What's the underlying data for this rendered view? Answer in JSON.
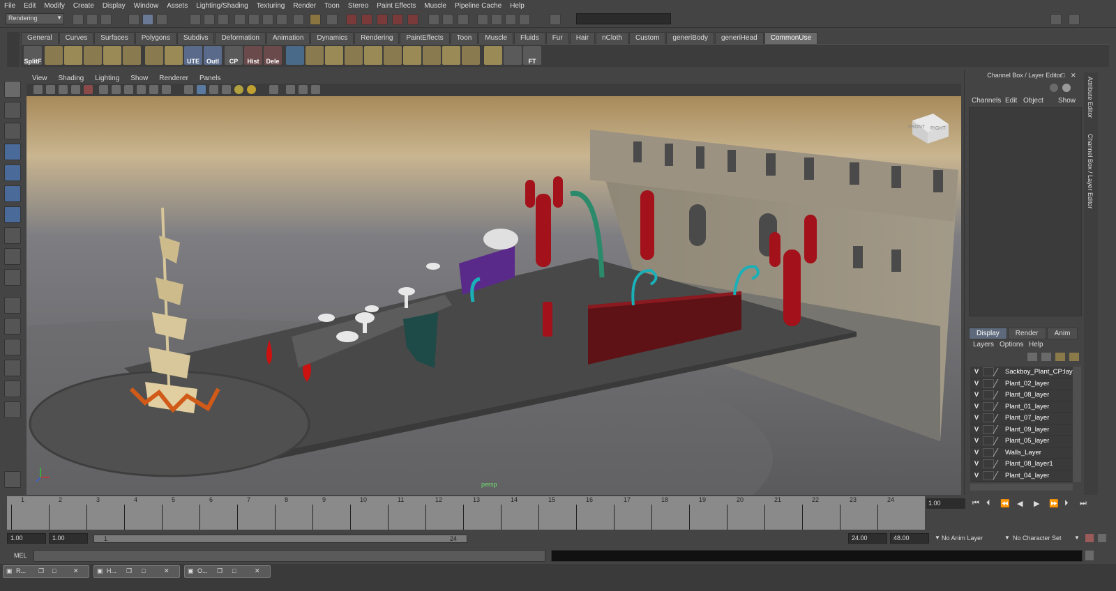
{
  "menubar": [
    "File",
    "Edit",
    "Modify",
    "Create",
    "Display",
    "Window",
    "Assets",
    "Lighting/Shading",
    "Texturing",
    "Render",
    "Toon",
    "Stereo",
    "Paint Effects",
    "Muscle",
    "Pipeline Cache",
    "Help"
  ],
  "status": {
    "mode": "Rendering"
  },
  "shelf": {
    "tabs": [
      "General",
      "Curves",
      "Surfaces",
      "Polygons",
      "Subdivs",
      "Deformation",
      "Animation",
      "Dynamics",
      "Rendering",
      "PaintEffects",
      "Toon",
      "Muscle",
      "Fluids",
      "Fur",
      "Hair",
      "nCloth",
      "Custom",
      "generiBody",
      "generiHead",
      "CommonUse"
    ],
    "active_tab": "CommonUse",
    "buttons": [
      "SplitF",
      "UTE",
      "Outl",
      "CP",
      "Hist",
      "Dele",
      "FT"
    ]
  },
  "viewport": {
    "menu": [
      "View",
      "Shading",
      "Lighting",
      "Show",
      "Renderer",
      "Panels"
    ],
    "camera": "persp",
    "viewcube": {
      "front": "FRONT",
      "right": "RIGHT"
    }
  },
  "channel_box": {
    "title": "Channel Box / Layer Editor",
    "menu": [
      "Channels",
      "Edit",
      "Object",
      "Show"
    ],
    "layer_tabs": [
      "Display",
      "Render",
      "Anim"
    ],
    "active_layer_tab": "Display",
    "layer_menu": [
      "Layers",
      "Options",
      "Help"
    ],
    "layers": [
      "Sackboy_Plant_CP:lay",
      "Plant_02_layer",
      "Plant_08_layer",
      "Plant_01_layer",
      "Plant_07_layer",
      "Plant_09_layer",
      "Plant_05_layer",
      "Walls_Layer",
      "Plant_08_layer1",
      "Plant_04_layer"
    ],
    "visibility_flag": "V"
  },
  "side_tabs": [
    "Attribute Editor",
    "Channel Box / Layer Editor"
  ],
  "timeline": {
    "frames": [
      "1",
      "2",
      "3",
      "4",
      "5",
      "6",
      "7",
      "8",
      "9",
      "10",
      "11",
      "12",
      "13",
      "14",
      "15",
      "16",
      "17",
      "18",
      "19",
      "20",
      "21",
      "22",
      "23",
      "24"
    ],
    "current_time": "1.00"
  },
  "range": {
    "start": "1.00",
    "playback_start": "1.00",
    "slider_start": "1",
    "slider_end": "24",
    "playback_end": "24.00",
    "end": "48.00",
    "anim_layer": "No Anim Layer",
    "character_set": "No Character Set"
  },
  "command_line": {
    "label": "MEL"
  },
  "taskbar": [
    {
      "label": "R..."
    },
    {
      "label": "H..."
    },
    {
      "label": "O..."
    }
  ],
  "colors": {
    "accent": "#5e6a7c",
    "plant_red": "#a3121a",
    "teal": "#1ab0b8"
  }
}
